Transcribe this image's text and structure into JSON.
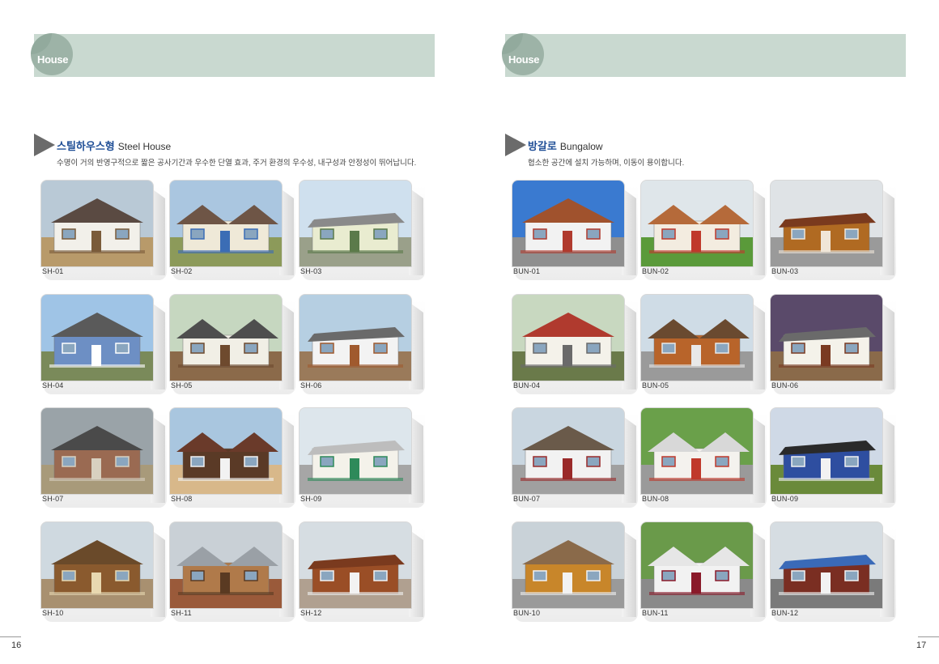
{
  "left": {
    "header": "House",
    "title_ko": "스틸하우스형",
    "title_en": "Steel House",
    "description": "수명이 거의 반영구적으로 짧은 공사기간과 우수한 단열 효과, 주거 환경의 우수성, 내구성과 안정성이 뛰어납니다.",
    "items": [
      "SH-01",
      "SH-02",
      "SH-03",
      "SH-04",
      "SH-05",
      "SH-06",
      "SH-07",
      "SH-08",
      "SH-09",
      "SH-10",
      "SH-11",
      "SH-12"
    ],
    "page_number": "16"
  },
  "right": {
    "header": "House",
    "title_ko": "방갈로",
    "title_en": "Bungalow",
    "description": "협소한 공간에 설치 가능하며, 이동이 용이합니다.",
    "items": [
      "BUN-01",
      "BUN-02",
      "BUN-03",
      "BUN-04",
      "BUN-05",
      "BUN-06",
      "BUN-07",
      "BUN-08",
      "BUN-09",
      "BUN-10",
      "BUN-11",
      "BUN-12"
    ],
    "page_number": "17"
  },
  "colors": {
    "header_bar": "#c9d9d0",
    "header_circle": "#9db3a7",
    "title_ko": "#1f4e96"
  }
}
